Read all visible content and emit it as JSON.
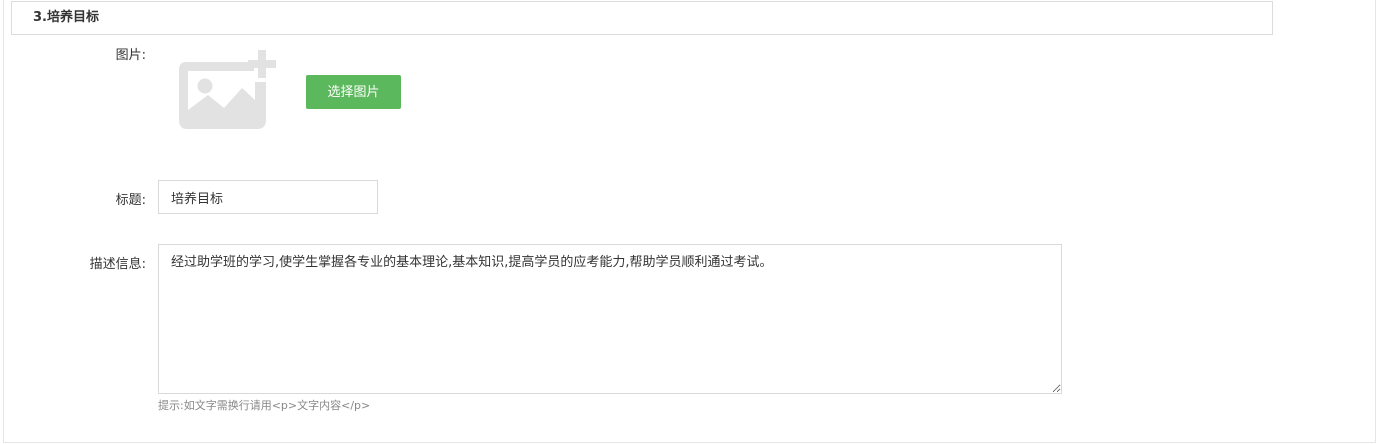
{
  "section": {
    "title": "3.培养目标"
  },
  "image_field": {
    "label": "图片:",
    "placeholder_icon": "add-image-icon",
    "button_label": "选择图片"
  },
  "title_field": {
    "label": "标题:",
    "value": "培养目标"
  },
  "description_field": {
    "label": "描述信息:",
    "value": "经过助学班的学习,使学生掌握各专业的基本理论,基本知识,提高学员的应考能力,帮助学员顺利通过考试。",
    "hint": "提示:如文字需换行请用<p>文字内容</p>"
  },
  "colors": {
    "button_bg": "#5cb85c",
    "placeholder_gray": "#e2e2e2"
  }
}
